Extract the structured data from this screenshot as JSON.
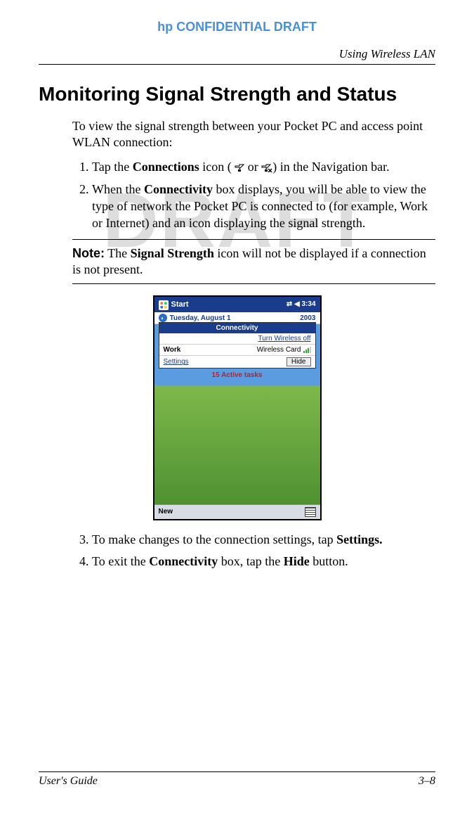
{
  "header": {
    "confidential": "hp CONFIDENTIAL DRAFT",
    "chapter": "Using Wireless LAN"
  },
  "watermark": "DRAFT",
  "heading": "Monitoring Signal Strength and Status",
  "intro": "To view the signal strength between your Pocket PC and access point WLAN connection:",
  "steps": {
    "s1_a": "Tap the ",
    "s1_b": "Connections",
    "s1_c": " icon ( ",
    "s1_d": " or ",
    "s1_e": ") in the Navigation bar.",
    "s2_a": "When the ",
    "s2_b": "Connectivity",
    "s2_c": " box displays, you will be able to view the type of network the Pocket PC is connected to (for example, Work or Internet) and an icon displaying the signal strength.",
    "s3_a": "To make changes to the connection settings, tap ",
    "s3_b": "Settings.",
    "s4_a": "To exit the ",
    "s4_b": "Connectivity",
    "s4_c": " box, tap the ",
    "s4_d": "Hide",
    "s4_e": " button."
  },
  "note": {
    "label": "Note:",
    "a": " The ",
    "b": "Signal Strength",
    "c": " icon will not be displayed if a connection is not present."
  },
  "screenshot": {
    "start": "Start",
    "time": "3:34",
    "date": "Tuesday, August 1",
    "year": "2003",
    "popup_title": "Connectivity",
    "turn_off": "Turn Wireless off",
    "network": "Work",
    "card": "Wireless Card",
    "settings": "Settings",
    "hide": "Hide",
    "tasks": "15 Active tasks",
    "new": "New"
  },
  "footer": {
    "left": "User's Guide",
    "right": "3–8"
  }
}
